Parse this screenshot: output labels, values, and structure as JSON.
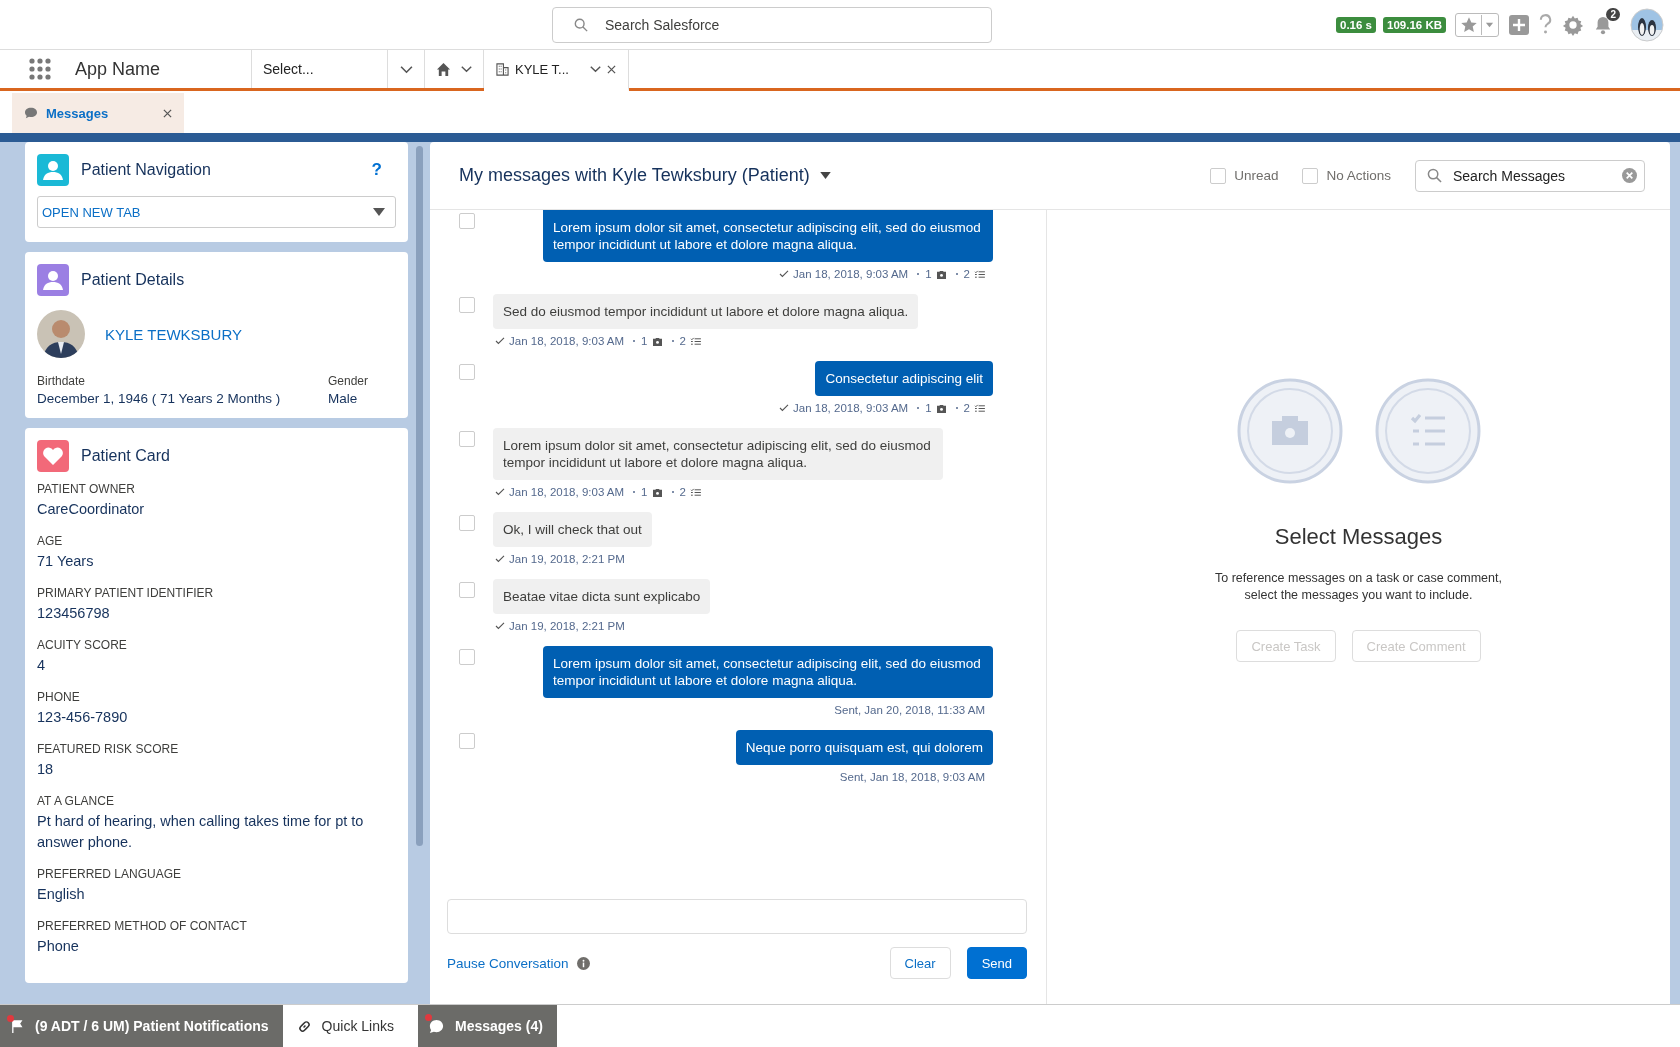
{
  "header": {
    "search_placeholder": "Search Salesforce",
    "badges": [
      "0.16 s",
      "109.16 KB"
    ],
    "notification_count": "2"
  },
  "nav": {
    "app_name": "App Name",
    "select_placeholder": "Select...",
    "tabs": [
      {
        "label": "KYLE T...",
        "selected": true
      }
    ]
  },
  "subtabs": [
    {
      "label": "Messages",
      "selected": true
    }
  ],
  "patient_navigation": {
    "title": "Patient Navigation",
    "help": "?",
    "dropdown_value": "OPEN NEW TAB"
  },
  "patient_details": {
    "title": "Patient Details",
    "name": "KYLE TEWKSBURY",
    "fields": [
      {
        "label": "Birthdate",
        "value": "December 1, 1946 ( 71 Years 2 Months )"
      },
      {
        "label": "Gender",
        "value": "Male"
      }
    ]
  },
  "patient_card": {
    "title": "Patient Card",
    "fields": [
      {
        "label": "PATIENT OWNER",
        "value": "CareCoordinator"
      },
      {
        "label": "AGE",
        "value": "71 Years"
      },
      {
        "label": "PRIMARY PATIENT IDENTIFIER",
        "value": "123456798"
      },
      {
        "label": "ACUITY SCORE",
        "value": "4"
      },
      {
        "label": "PHONE",
        "value": "123-456-7890"
      },
      {
        "label": "FEATURED RISK SCORE",
        "value": "18"
      },
      {
        "label": "AT A GLANCE",
        "value": "Pt hard of hearing, when calling takes time for pt to answer phone."
      },
      {
        "label": "PREFERRED LANGUAGE",
        "value": "English"
      },
      {
        "label": "PREFERRED METHOD OF CONTACT",
        "value": "Phone"
      }
    ]
  },
  "conversation": {
    "title": "My messages with Kyle Tewksbury (Patient)",
    "filters": [
      {
        "label": "Unread",
        "checked": false
      },
      {
        "label": "No Actions",
        "checked": false
      }
    ],
    "search_placeholder": "Search Messages",
    "messages": [
      {
        "kind": "outgoing",
        "checked": false,
        "text": "Lorem ipsum dolor sit amet, consectetur adipiscing elit, sed do eiusmod tempor incididunt ut labore et dolore magna aliqua.",
        "read": true,
        "time": "Jan 18, 2018, 9:03 AM",
        "attachments": "1",
        "tasks": "2"
      },
      {
        "kind": "incoming",
        "checked": false,
        "text": "Sed do eiusmod tempor incididunt ut labore et dolore magna aliqua.",
        "read": true,
        "time": "Jan 18, 2018, 9:03 AM",
        "attachments": "1",
        "tasks": "2"
      },
      {
        "kind": "outgoing",
        "checked": false,
        "text": "Consectetur adipiscing elit",
        "read": true,
        "time": "Jan 18, 2018, 9:03 AM",
        "attachments": "1",
        "tasks": "2"
      },
      {
        "kind": "incoming",
        "checked": false,
        "text": "Lorem ipsum dolor sit amet, consectetur adipiscing elit, sed do eiusmod tempor incididunt ut labore et dolore magna aliqua.",
        "read": true,
        "time": "Jan 18, 2018, 9:03 AM",
        "attachments": "1",
        "tasks": "2"
      },
      {
        "kind": "incoming",
        "checked": false,
        "text": "Ok, I will check that out",
        "read": true,
        "time": "Jan 19, 2018, 2:21 PM"
      },
      {
        "kind": "incoming",
        "checked": false,
        "text": "Beatae vitae dicta sunt explicabo",
        "read": true,
        "time": "Jan 19, 2018, 2:21 PM"
      },
      {
        "kind": "outgoing",
        "checked": false,
        "text": "Lorem ipsum dolor sit amet, consectetur adipiscing elit, sed do eiusmod tempor incididunt ut labore et dolore magna aliqua.",
        "read": false,
        "time": "Sent, Jan 20, 2018, 11:33 AM"
      },
      {
        "kind": "outgoing",
        "checked": false,
        "text": "Neque porro quisquam est, qui dolorem",
        "read": false,
        "time": "Sent, Jan 18, 2018, 9:03 AM"
      }
    ],
    "pause_link": "Pause Conversation",
    "buttons": [
      "Clear",
      "Send"
    ]
  },
  "selection": {
    "title": "Select Messages",
    "description": "To reference messages on a task or case comment, select the messages you want to include.",
    "buttons": [
      {
        "label": "Create Task",
        "disabled": true
      },
      {
        "label": "Create Comment",
        "disabled": true
      }
    ]
  },
  "utility_bar": [
    {
      "label": "(9 ADT / 6 UM) Patient Notifications",
      "kind": "notifications",
      "alert": true,
      "selected": false
    },
    {
      "label": "Quick Links",
      "kind": "links",
      "alert": false,
      "selected": true
    },
    {
      "label": "Messages (4)",
      "kind": "messages",
      "alert": true,
      "selected": false
    }
  ]
}
